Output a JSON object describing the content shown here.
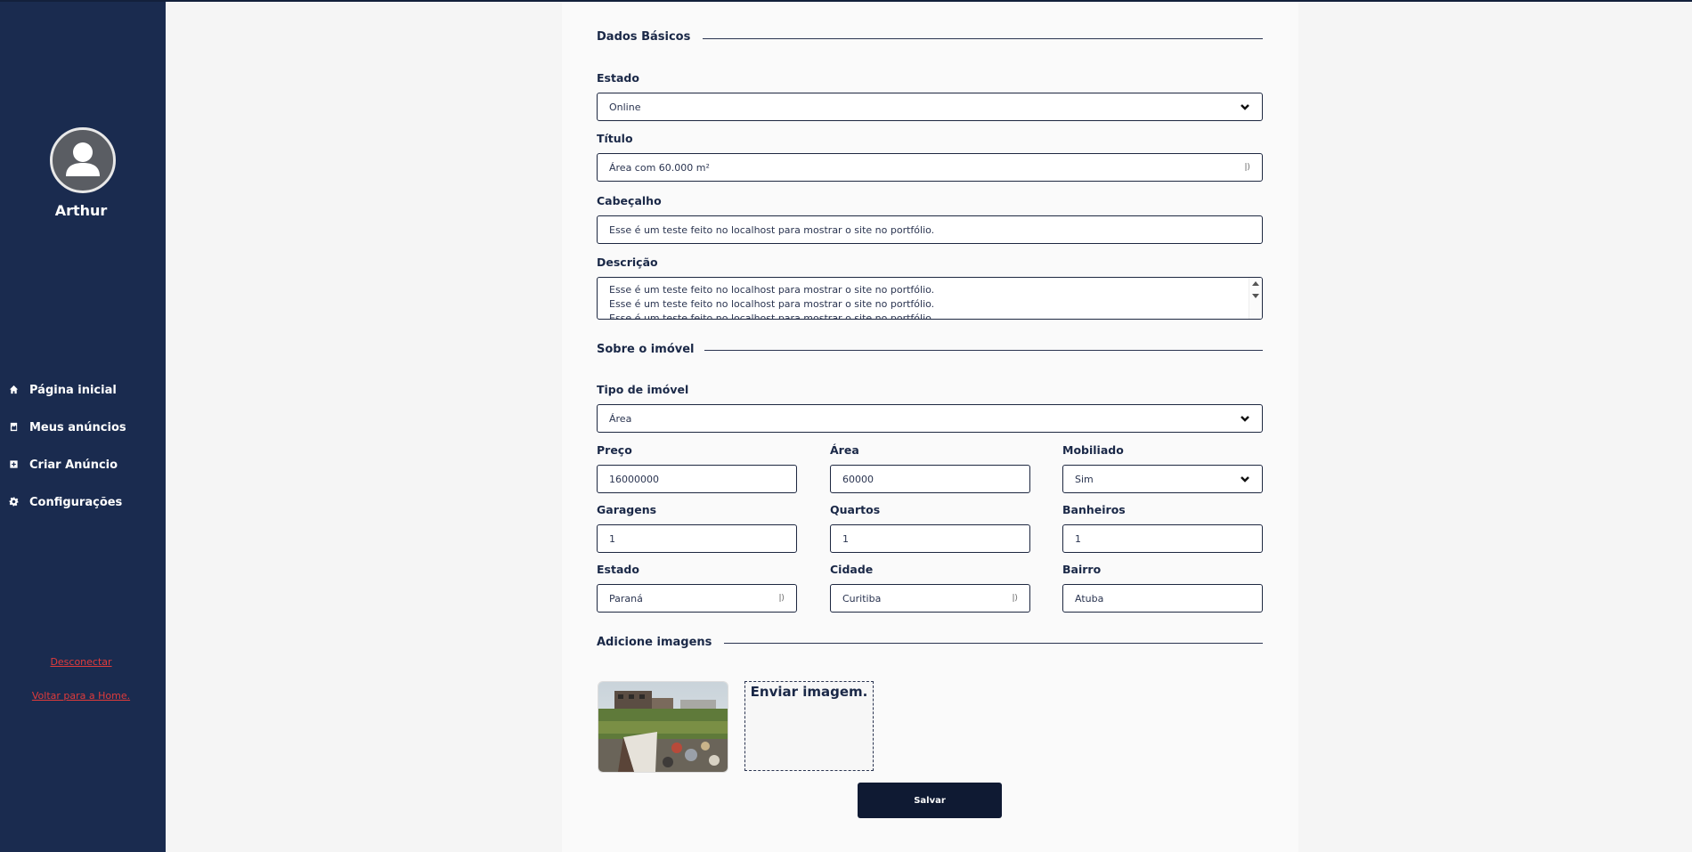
{
  "sidebar": {
    "username": "Arthur",
    "nav": [
      {
        "label": "Página inicial",
        "icon": "home-icon"
      },
      {
        "label": "Meus anúncios",
        "icon": "ads-icon"
      },
      {
        "label": "Criar Anúncio",
        "icon": "plus-square-icon"
      },
      {
        "label": "Configurações",
        "icon": "gear-icon"
      }
    ],
    "logout": "Desconectar",
    "back_home": "Voltar para a Home."
  },
  "basic": {
    "section": "Dados Básicos",
    "status_label": "Estado",
    "status_value": "Online",
    "title_label": "Título",
    "title_value": "Área com 60.000 m²",
    "header_label": "Cabeçalho",
    "header_value": "Esse é um teste feito no localhost para mostrar o site no portfólio.",
    "desc_label": "Descrição",
    "desc_value": "Esse é um teste feito no localhost para mostrar o site no portfólio.\nEsse é um teste feito no localhost para mostrar o site no portfólio.\nEsse é um teste feito no localhost para mostrar o site no portfólio."
  },
  "property": {
    "section": "Sobre o imóvel",
    "type_label": "Tipo de imóvel",
    "type_value": "Área",
    "price_label": "Preço",
    "price_value": "16000000",
    "area_label": "Área",
    "area_value": "60000",
    "furnished_label": "Mobiliado",
    "furnished_value": "Sim",
    "garages_label": "Garagens",
    "garages_value": "1",
    "rooms_label": "Quartos",
    "rooms_value": "1",
    "baths_label": "Banheiros",
    "baths_value": "1",
    "state_label": "Estado",
    "state_value": "Paraná",
    "city_label": "Cidade",
    "city_value": "Curitiba",
    "district_label": "Bairro",
    "district_value": "Atuba"
  },
  "images": {
    "section": "Adicione imagens",
    "upload_label": "Enviar imagem."
  },
  "save_label": "Salvar"
}
